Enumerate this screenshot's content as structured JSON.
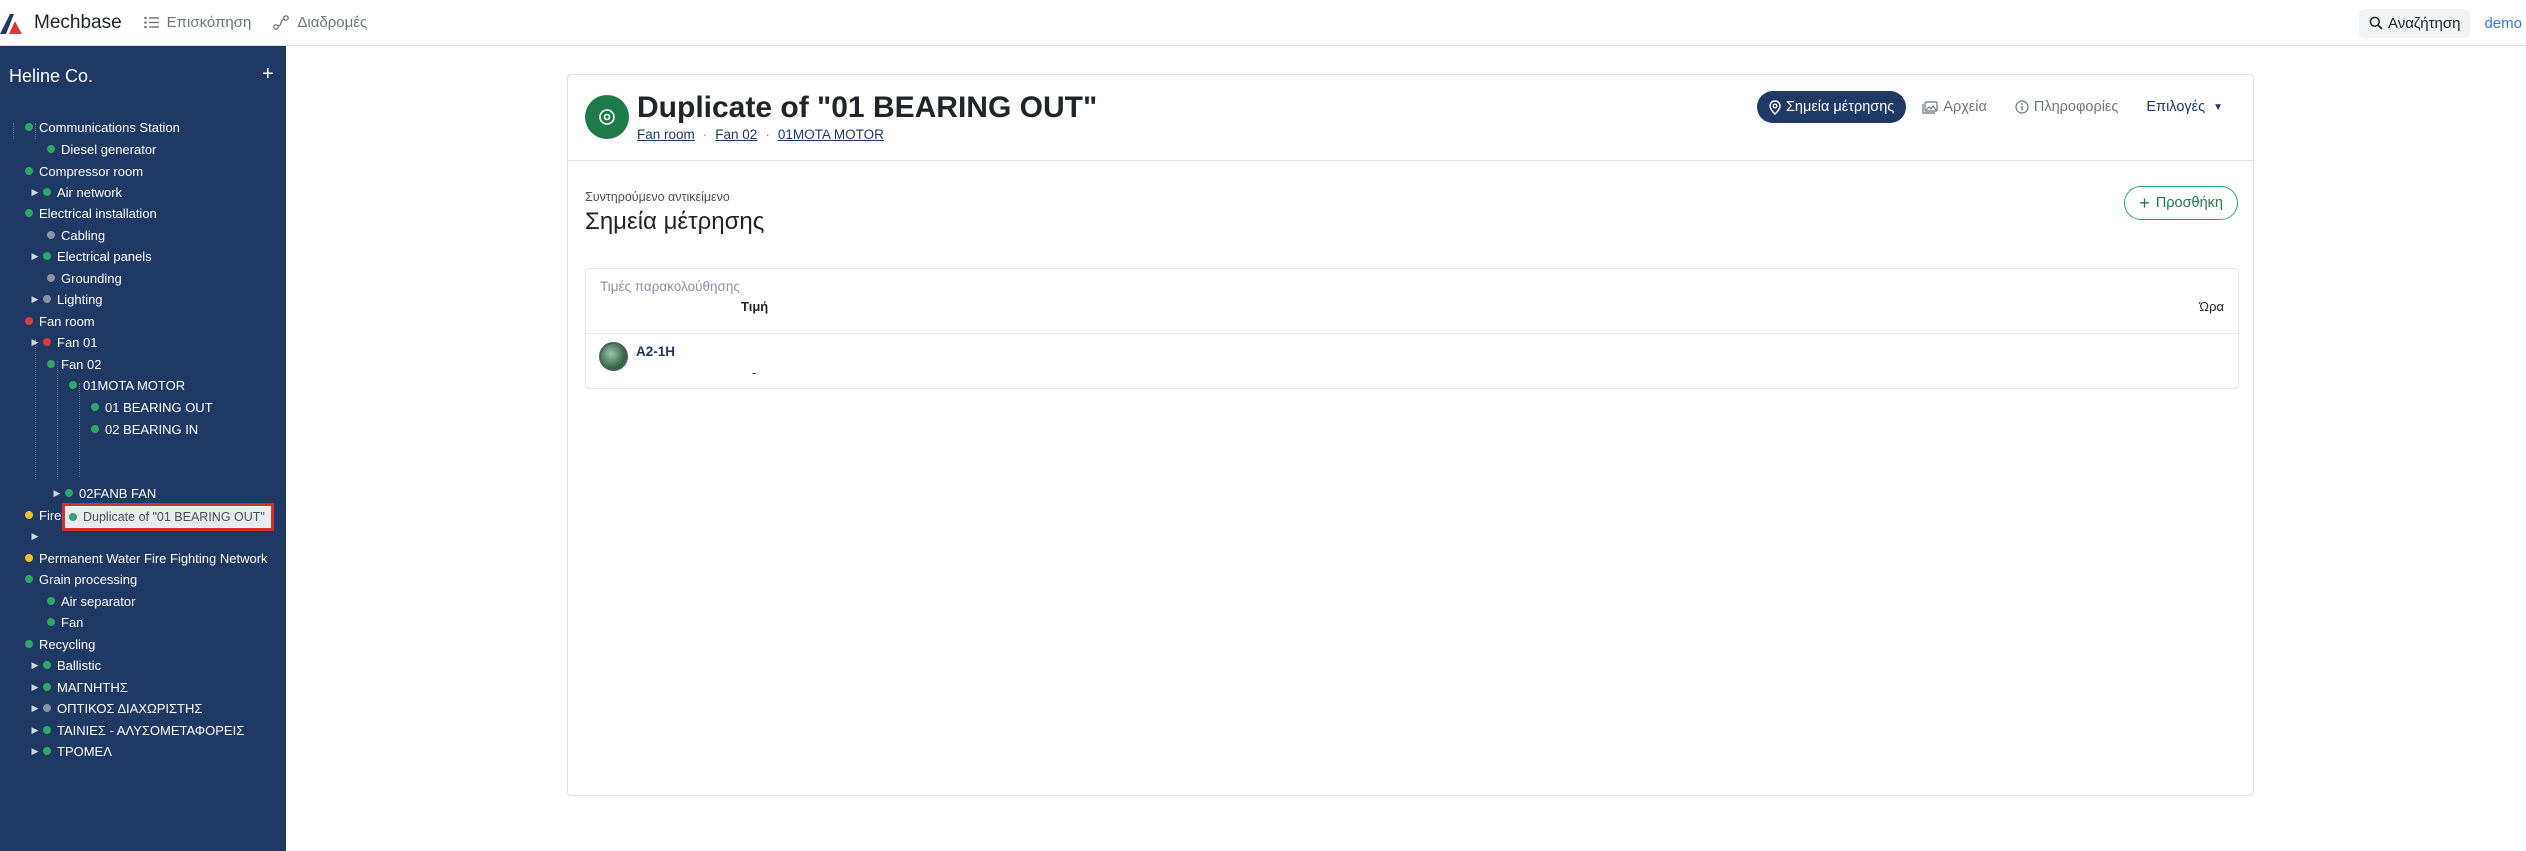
{
  "app": {
    "name": "Mechbase"
  },
  "topnav": {
    "items": [
      {
        "label": "Επισκόπηση",
        "icon": "list-icon"
      },
      {
        "label": "Διαδρομές",
        "icon": "route-icon"
      }
    ],
    "search_label": "Αναζήτηση",
    "user": "demo"
  },
  "sidebar": {
    "company": "Heline Co.",
    "add_symbol": "+",
    "tree": [
      {
        "label": "Communications Station",
        "status": "green",
        "level": 0
      },
      {
        "label": "Diesel generator",
        "status": "green",
        "level": 1
      },
      {
        "label": "Compressor room",
        "status": "green",
        "level": 0
      },
      {
        "label": "Air network",
        "status": "green",
        "level": 1,
        "expandable": true
      },
      {
        "label": "Electrical installation",
        "status": "green",
        "level": 0
      },
      {
        "label": "Cabling",
        "status": "gray",
        "level": 1
      },
      {
        "label": "Electrical panels",
        "status": "green",
        "level": 1,
        "expandable": true
      },
      {
        "label": "Grounding",
        "status": "gray",
        "level": 1
      },
      {
        "label": "Lighting",
        "status": "gray",
        "level": 1,
        "expandable": true
      },
      {
        "label": "Fan room",
        "status": "red",
        "level": 0
      },
      {
        "label": "Fan 01",
        "status": "red",
        "level": 1,
        "expandable": true
      },
      {
        "label": "Fan 02",
        "status": "green",
        "level": 1
      },
      {
        "label": "01MOTA MOTOR",
        "status": "green",
        "level": 2
      },
      {
        "label": "01 BEARING OUT",
        "status": "green",
        "level": 3
      },
      {
        "label": "02 BEARING IN",
        "status": "green",
        "level": 3
      },
      {
        "label": "Duplicate of \"01 BEARING OUT\"",
        "status": "green",
        "level": 3,
        "selected": true
      },
      {
        "label": "02FANB FAN",
        "status": "green",
        "level": 2,
        "expandable": true
      },
      {
        "label": "Fire protection",
        "status": "yellow",
        "level": 0
      },
      {
        "label": "Permanent Water Fire Fighting Network",
        "status": "yellow",
        "level": 0
      },
      {
        "label": "Grain processing",
        "status": "green",
        "level": 0
      },
      {
        "label": "Air separator",
        "status": "green",
        "level": 1
      },
      {
        "label": "Fan",
        "status": "green",
        "level": 1
      },
      {
        "label": "Recycling",
        "status": "green",
        "level": 0
      },
      {
        "label": "Ballistic",
        "status": "green",
        "level": 1,
        "expandable": true
      },
      {
        "label": "ΜΑΓΝΗΤΗΣ",
        "status": "green",
        "level": 1,
        "expandable": true
      },
      {
        "label": "ΟΠΤΙΚΟΣ ΔΙΑΧΩΡΙΣΤΗΣ",
        "status": "gray",
        "level": 1,
        "expandable": true
      },
      {
        "label": "ΤΑΙΝΙΕΣ - ΑΛΥΣΟΜΕΤΑΦΟΡΕΙΣ",
        "status": "green",
        "level": 1,
        "expandable": true
      },
      {
        "label": "ΤΡΟΜΕΛ",
        "status": "green",
        "level": 1,
        "expandable": true
      }
    ]
  },
  "object": {
    "title": "Duplicate of \"01 BEARING OUT\"",
    "breadcrumbs": [
      "Fan room",
      "Fan 02",
      "01MOTA MOTOR"
    ],
    "tabs": [
      {
        "label": "Σημεία μέτρησης",
        "icon": "map-pin-icon",
        "active": true
      },
      {
        "label": "Αρχεία",
        "icon": "images-icon"
      },
      {
        "label": "Πληροφορίες",
        "icon": "info-icon"
      },
      {
        "label": "Επιλογές",
        "icon": "caret-down-icon"
      }
    ]
  },
  "section": {
    "subtitle": "Συντηρούμενο αντικείμενο",
    "title": "Σημεία μέτρησης",
    "add_label": "Προσθήκη"
  },
  "table": {
    "caption": "Τιμές παρακολούθησης",
    "columns": [
      "Τιμή",
      "Ώρα"
    ],
    "rows": [
      {
        "name": "A2-1H",
        "value": "-"
      }
    ]
  },
  "colors": {
    "sidebar": "#1f3864",
    "accent": "#1f3864",
    "ok": "#2ea76b",
    "alarm": "#e03b3b",
    "warning": "#f2c02b",
    "inactive": "#8a93a3"
  }
}
